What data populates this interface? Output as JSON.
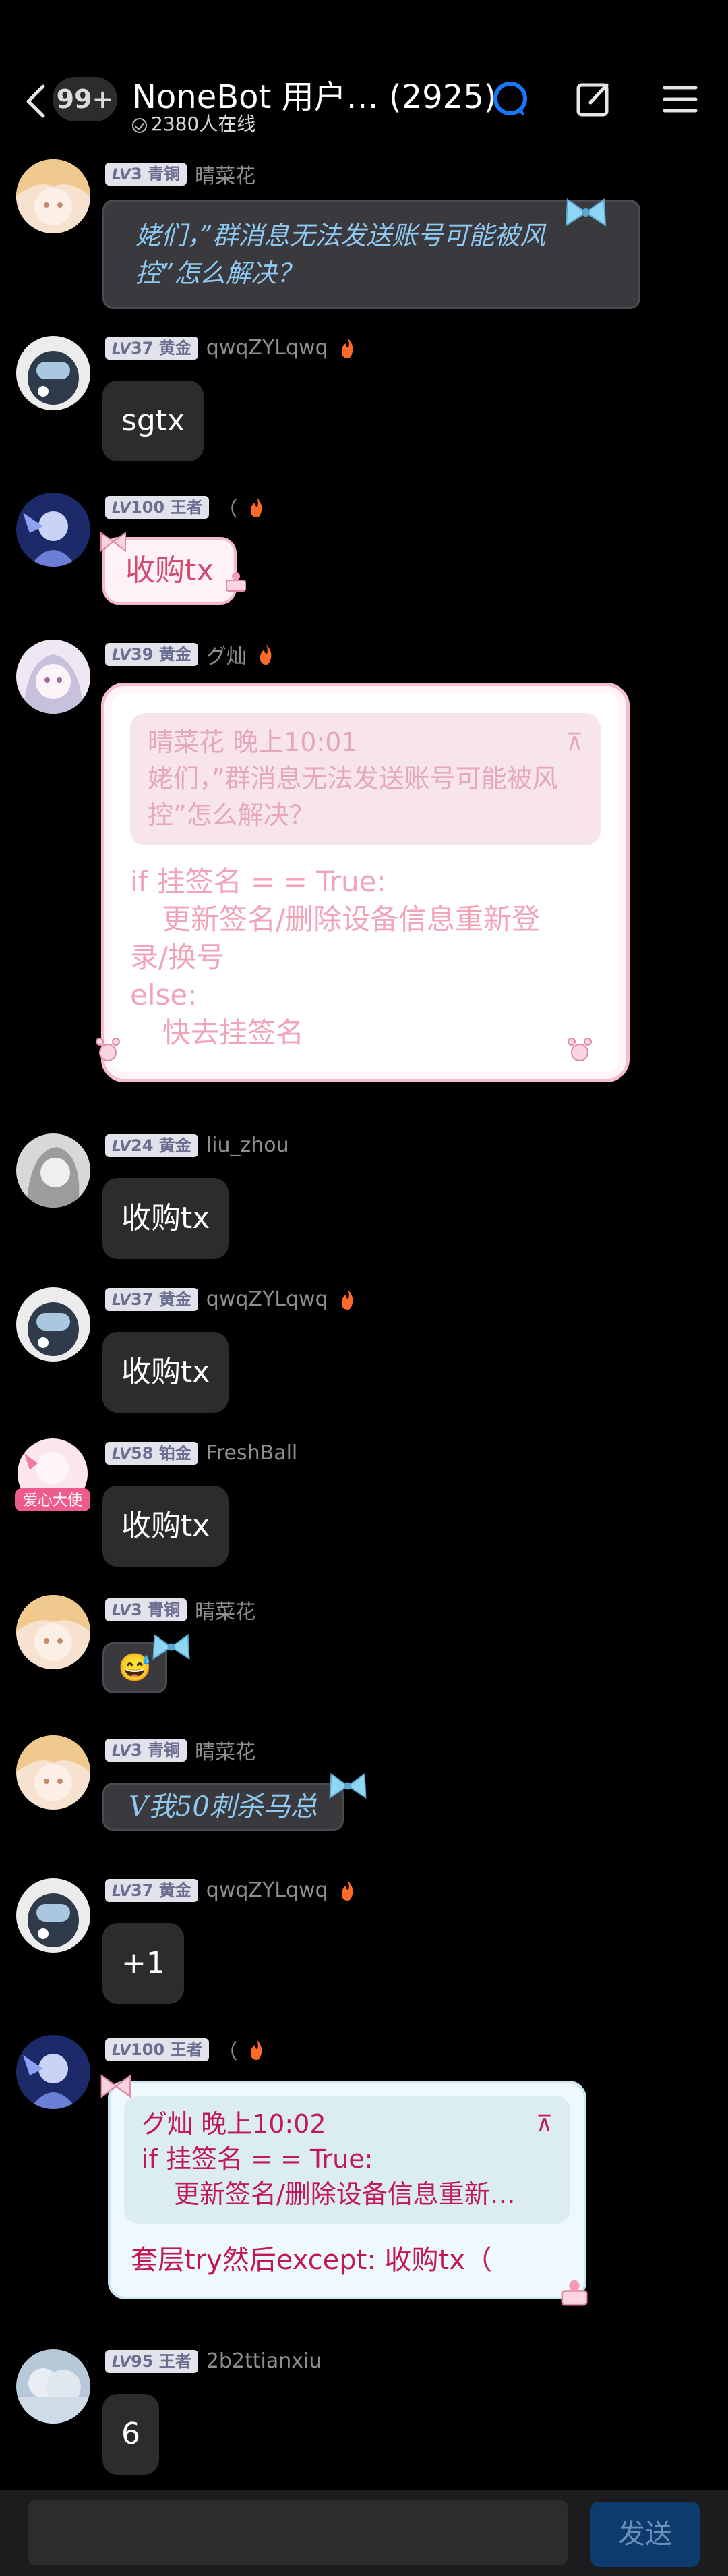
{
  "header": {
    "unread_count": "99+",
    "title": "NoneBot 用户…  (2925)",
    "online_text": "2380人在线"
  },
  "messages": [
    {
      "level": "3",
      "rank": "青铜",
      "nick": "晴菜花",
      "text": "姥们，”群消息无法发送账号可能被风控”怎么解决？"
    },
    {
      "level": "37",
      "rank": "黄金",
      "nick": "qwqZYLqwq",
      "text": "sgtx"
    },
    {
      "level": "100",
      "rank": "王者",
      "nick": "（",
      "text": "收购tx"
    },
    {
      "level": "39",
      "rank": "黄金",
      "nick": "グ灿",
      "quote_author": "晴菜花 晚上10:01",
      "quote_text": "姥们，”群消息无法发送账号可能被风控”怎么解决？",
      "lines": [
        "if 挂签名 = = True:",
        "    更新签名/删除设备信息重新登",
        "录/换号",
        "else:",
        "    快去挂签名"
      ]
    },
    {
      "level": "24",
      "rank": "黄金",
      "nick": "liu_zhou",
      "text": "收购tx"
    },
    {
      "level": "37",
      "rank": "黄金",
      "nick": "qwqZYLqwq",
      "text": "收购tx"
    },
    {
      "level": "58",
      "rank": "铂金",
      "nick": "FreshBall",
      "text": "收购tx"
    },
    {
      "level": "3",
      "rank": "青铜",
      "nick": "晴菜花",
      "text": "😅"
    },
    {
      "level": "3",
      "rank": "青铜",
      "nick": "晴菜花",
      "text": "V我50刺杀马总"
    },
    {
      "level": "37",
      "rank": "黄金",
      "nick": "qwqZYLqwq",
      "text": "+1"
    },
    {
      "level": "100",
      "rank": "王者",
      "nick": "（",
      "quote_author": "グ灿 晚上10:02",
      "quote_lines": [
        "if 挂签名 = = True:",
        "    更新签名/删除设备信息重新…"
      ],
      "text": "套层try然后except: 收购tx（"
    },
    {
      "level": "95",
      "rank": "王者",
      "nick": "2b2ttianxiu",
      "text": "6"
    }
  ],
  "avatar_text": {
    "freshball": "爱心大使"
  },
  "input": {
    "send_label": "发送"
  },
  "colors": {
    "background": "#000000",
    "bubble": "#2c2c2e",
    "accent": "#1677ff",
    "send_button": "#0d3b6e"
  }
}
